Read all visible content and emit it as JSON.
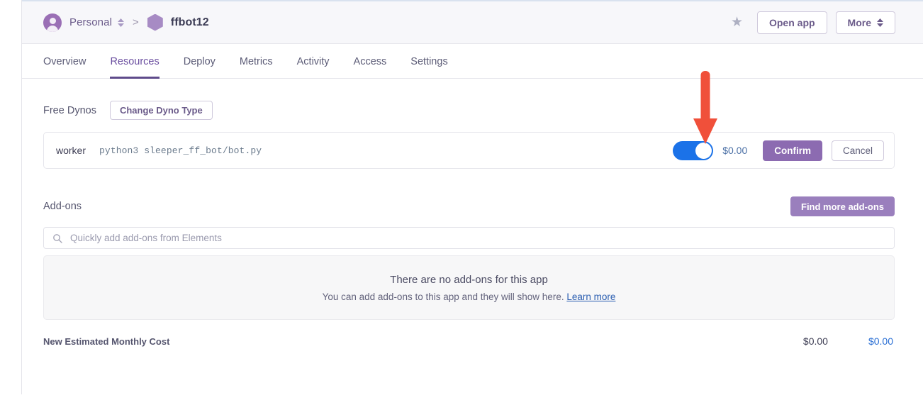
{
  "header": {
    "org_name": "Personal",
    "org_caret_icon": "caret-updown-icon",
    "separator": ">",
    "app_icon": "hexagon-app-icon",
    "app_name": "ffbot12",
    "star_icon": "★",
    "open_app_label": "Open app",
    "more_label": "More",
    "more_caret_icon": "caret-updown-icon"
  },
  "tabs": [
    {
      "label": "Overview",
      "active": false
    },
    {
      "label": "Resources",
      "active": true
    },
    {
      "label": "Deploy",
      "active": false
    },
    {
      "label": "Metrics",
      "active": false
    },
    {
      "label": "Activity",
      "active": false
    },
    {
      "label": "Access",
      "active": false
    },
    {
      "label": "Settings",
      "active": false
    }
  ],
  "dynos": {
    "section_title": "Free Dynos",
    "change_type_label": "Change Dyno Type",
    "row": {
      "process_name": "worker",
      "command": "python3 sleeper_ff_bot/bot.py",
      "toggle_state": "on",
      "price": "$0.00",
      "confirm_label": "Confirm",
      "cancel_label": "Cancel"
    }
  },
  "addons": {
    "section_title": "Add-ons",
    "find_more_label": "Find more add-ons",
    "search_placeholder": "Quickly add add-ons from Elements",
    "search_value": "",
    "search_icon": "search-icon",
    "empty_title": "There are no add-ons for this app",
    "empty_subtitle": "You can add add-ons to this app and they will show here.",
    "empty_link_label": "Learn more"
  },
  "cost": {
    "label": "New Estimated Monthly Cost",
    "previous_value": "$0.00",
    "new_value": "$0.00"
  },
  "annotation": {
    "arrow_icon": "down-arrow-annotation",
    "color": "#f0503a"
  },
  "colors": {
    "brand_purple": "#5f4b8b",
    "confirm_purple": "#8c6bb1",
    "find_purple": "#9a7fbd",
    "toggle_blue": "#1b72e8",
    "link_blue": "#2a6fd4",
    "annotation_red": "#f0503a"
  }
}
